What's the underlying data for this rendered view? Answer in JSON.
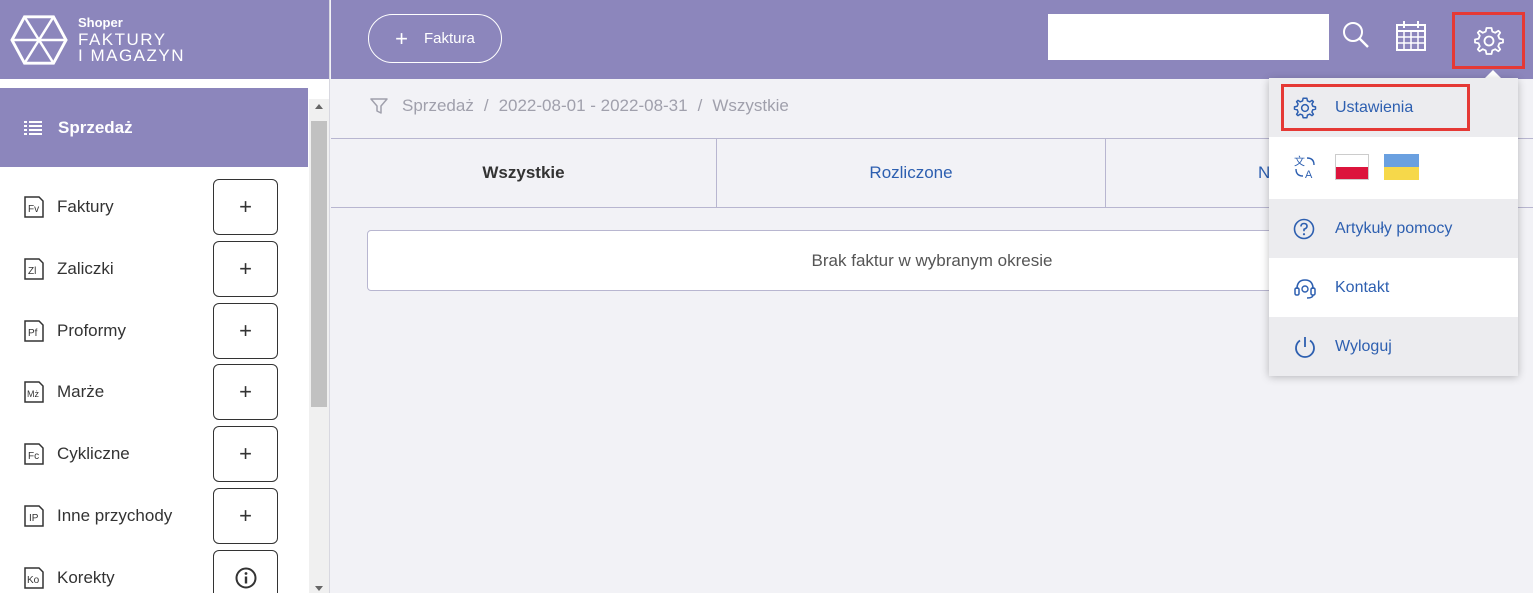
{
  "logo": {
    "small": "Shoper",
    "line1": "FAKTURY",
    "line2": "I MAGAZYN"
  },
  "sidebar": {
    "section_title": "Sprzedaż",
    "items": [
      {
        "label": "Faktury",
        "icon": "fv-doc-icon",
        "action": "+"
      },
      {
        "label": "Zaliczki",
        "icon": "zl-doc-icon",
        "action": "+"
      },
      {
        "label": "Proformy",
        "icon": "pf-doc-icon",
        "action": "+"
      },
      {
        "label": "Marże",
        "icon": "mz-doc-icon",
        "action": "+"
      },
      {
        "label": "Cykliczne",
        "icon": "fc-doc-icon",
        "action": "+"
      },
      {
        "label": "Inne przychody",
        "icon": "ip-doc-icon",
        "action": "+"
      },
      {
        "label": "Korekty",
        "icon": "ko-doc-icon",
        "action": "info"
      }
    ]
  },
  "topbar": {
    "new_button_label": "Faktura",
    "search_placeholder": "",
    "accent_color": "#8c86bc"
  },
  "breadcrumb": {
    "section": "Sprzedaż",
    "period": "2022-08-01 - 2022-08-31",
    "filter": "Wszystkie"
  },
  "tabs": [
    {
      "label": "Wszystkie",
      "active": true
    },
    {
      "label": "Rozliczone",
      "active": false
    },
    {
      "label": "N",
      "active": false
    }
  ],
  "main": {
    "empty_message": "Brak faktur w wybranym okresie"
  },
  "dropdown": {
    "settings": "Ustawienia",
    "help": "Artykuły pomocy",
    "contact": "Kontakt",
    "logout": "Wyloguj"
  }
}
